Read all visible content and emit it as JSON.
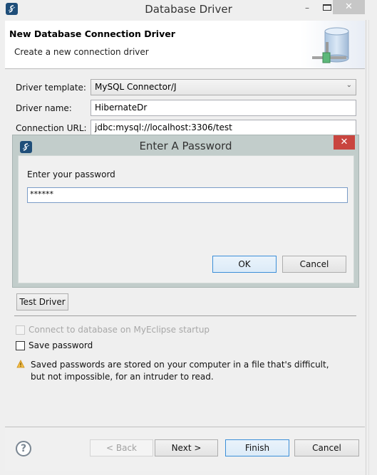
{
  "window": {
    "title": "Database Driver",
    "minimize_glyph": "–",
    "close_glyph": "✕"
  },
  "banner": {
    "title": "New Database Connection Driver",
    "subtitle": "Create a new connection driver"
  },
  "form": {
    "driver_template_label": "Driver template:",
    "driver_template_value": "MySQL Connector/J",
    "driver_name_label": "Driver name:",
    "driver_name_value": "HibernateDr",
    "connection_url_label": "Connection URL:",
    "connection_url_value": "jdbc:mysql://localhost:3306/test"
  },
  "password_dialog": {
    "title": "Enter A Password",
    "close_glyph": "✕",
    "prompt": "Enter your password",
    "password_value": "******",
    "ok_label": "OK",
    "cancel_label": "Cancel"
  },
  "options": {
    "test_driver_label": "Test Driver",
    "connect_on_startup_label": "Connect to database on MyEclipse startup",
    "connect_on_startup_checked": false,
    "connect_on_startup_enabled": false,
    "save_password_label": "Save password",
    "save_password_checked": false,
    "warning_text": "Saved passwords are stored on your computer in a file that's difficult, but not impossible, for an intruder to read."
  },
  "footer": {
    "help_glyph": "?",
    "back_label": "< Back",
    "next_label": "Next >",
    "finish_label": "Finish",
    "cancel_label": "Cancel"
  },
  "colors": {
    "close_button_red": "#c9453f",
    "default_button_border": "#3c8fd8",
    "app_icon_blue": "#1f4e79"
  }
}
